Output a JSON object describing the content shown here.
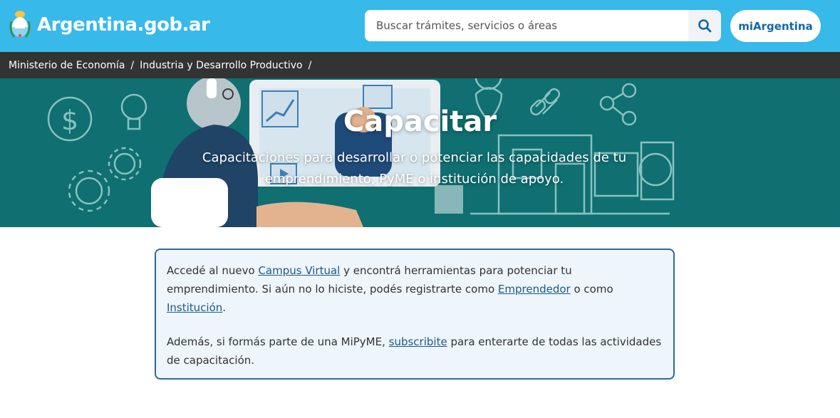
{
  "header": {
    "logo_text": "Argentina.gob.ar",
    "search_placeholder": "Buscar trámites, servicios o áreas",
    "search_icon": "search-icon",
    "account_button": "miArgentina",
    "colors": {
      "bar": "#37b9e9",
      "account_text": "#1069a8"
    }
  },
  "breadcrumb": {
    "items": [
      "Ministerio de Economía",
      "Industria y Desarrollo Productivo"
    ],
    "separator": "/"
  },
  "hero": {
    "title": "Capacitar",
    "subtitle": "Capacitaciones para desarrollar o potenciar las capacidades de tu emprendimiento, PyME o institución de apoyo.",
    "background_color": "#0f6f71"
  },
  "notice": {
    "p1_before": "Accedé al nuevo ",
    "p1_link1": "Campus Virtual",
    "p1_mid1": " y encontrá herramientas para potenciar tu emprendimiento. Si aún no lo hiciste, podés registrarte como ",
    "p1_link2": "Emprendedor",
    "p1_mid2": " o como ",
    "p1_link3": "Institución",
    "p1_end": ".",
    "p2_before": "Además, si formás parte de una MiPyME, ",
    "p2_link": "subscribite",
    "p2_end": " para enterarte de todas las actividades de capacitación.",
    "colors": {
      "border": "#2c6b99",
      "background": "#eef5fb",
      "link": "#1c5a8a"
    }
  }
}
